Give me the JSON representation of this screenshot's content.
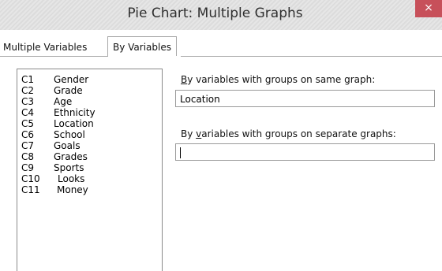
{
  "window": {
    "title": "Pie Chart: Multiple Graphs",
    "close_glyph": "×"
  },
  "tabs": [
    {
      "label": "Multiple Variables",
      "active": false
    },
    {
      "label": "By Variables",
      "active": true
    }
  ],
  "variables": [
    {
      "id": "C1",
      "name": "Gender"
    },
    {
      "id": "C2",
      "name": "Grade"
    },
    {
      "id": "C3",
      "name": "Age"
    },
    {
      "id": "C4",
      "name": "Ethnicity"
    },
    {
      "id": "C5",
      "name": "Location"
    },
    {
      "id": "C6",
      "name": "School"
    },
    {
      "id": "C7",
      "name": "Goals"
    },
    {
      "id": "C8",
      "name": "Grades"
    },
    {
      "id": "C9",
      "name": "Sports"
    },
    {
      "id": "C10",
      "name": "Looks"
    },
    {
      "id": "C11",
      "name": "Money"
    }
  ],
  "same_graph": {
    "label_accel": "B",
    "label_rest": "y variables with groups on same graph:",
    "value": "Location"
  },
  "separate_graphs": {
    "label_pre": "By ",
    "label_accel": "v",
    "label_rest": "ariables with groups on separate graphs:",
    "value": ""
  },
  "colors": {
    "close_button": "#c7505a",
    "title_text": "#303030"
  }
}
